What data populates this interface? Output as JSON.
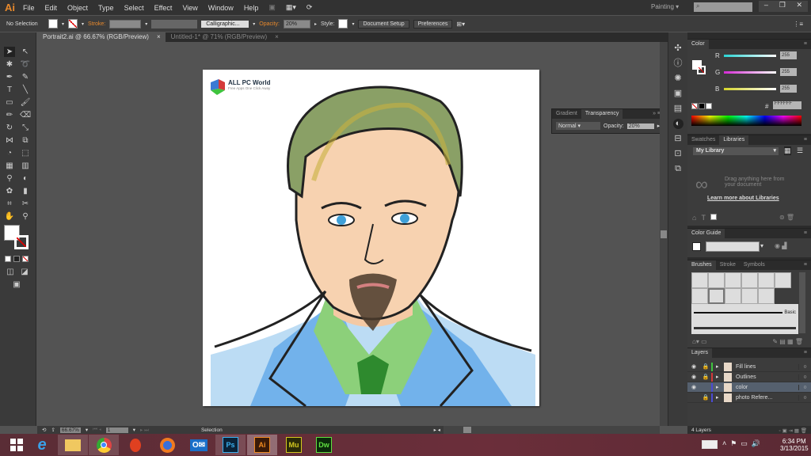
{
  "app": {
    "logo": "Ai",
    "menu": [
      "File",
      "Edit",
      "Object",
      "Type",
      "Select",
      "Effect",
      "View",
      "Window",
      "Help"
    ],
    "workspace": "Painting",
    "window_controls": [
      "minimize",
      "restore",
      "close"
    ]
  },
  "control": {
    "selection": "No Selection",
    "stroke_label": "Stroke:",
    "brush": "Calligraphic...",
    "opacity_label": "Opacity:",
    "opacity": "20%",
    "style_label": "Style:",
    "doc_setup": "Document Setup",
    "preferences": "Preferences"
  },
  "tabs": [
    {
      "label": "Portrait2.ai @ 66.67% (RGB/Preview)",
      "close": "×"
    },
    {
      "label": "Untitled-1* @ 71% (RGB/Preview)",
      "close": "×"
    }
  ],
  "artboard": {
    "watermark_title": "ALL PC World",
    "watermark_sub": "Free Apps One Click Away"
  },
  "transparency": {
    "tabs": [
      "Gradient",
      "Transparency"
    ],
    "mode": "Normal",
    "opacity_label": "Opacity:",
    "opacity": "20%"
  },
  "color": {
    "title": "Color",
    "channels": [
      {
        "label": "R",
        "value": "255",
        "color": "#2ad4d4"
      },
      {
        "label": "G",
        "value": "255",
        "color": "#d42ad4"
      },
      {
        "label": "B",
        "value": "255",
        "color": "#d4d42a"
      }
    ],
    "hash": "#",
    "hex": "FFFFFF"
  },
  "libraries": {
    "tabs": [
      "Swatches",
      "Libraries"
    ],
    "library": "My Library",
    "drag_text": "Drag anything here from your document",
    "learn": "Learn more about Libraries"
  },
  "color_guide": {
    "title": "Color Guide"
  },
  "brushes": {
    "tabs": [
      "Brushes",
      "Stroke",
      "Symbols"
    ],
    "basic": "Basic"
  },
  "layers": {
    "title": "Layers",
    "items": [
      {
        "name": "Fill lines",
        "color": "#3ec43e",
        "locked": true,
        "visible": true
      },
      {
        "name": "Outlines",
        "color": "#d43a3a",
        "locked": true,
        "visible": true
      },
      {
        "name": "color",
        "color": "#4a4ad4",
        "locked": false,
        "visible": true,
        "selected": true
      },
      {
        "name": "photo Refere...",
        "color": "#4a4ad4",
        "locked": true,
        "visible": false
      }
    ],
    "count": "4 Layers"
  },
  "status": {
    "zoom": "66.67%",
    "page": "1",
    "tool": "Selection"
  },
  "taskbar": {
    "apps": [
      "Start",
      "Internet Explorer",
      "File Explorer",
      "Chrome",
      "Opera",
      "Firefox",
      "Outlook",
      "Ps",
      "Ai",
      "Mu",
      "Dw"
    ],
    "time": "6:34 PM",
    "date": "3/13/2015"
  }
}
